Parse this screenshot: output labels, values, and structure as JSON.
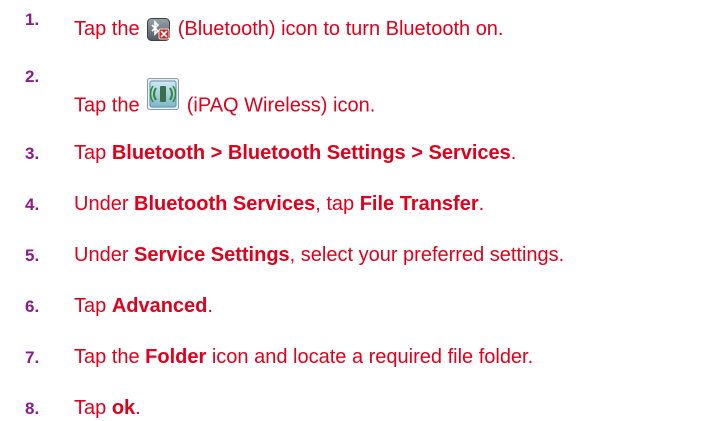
{
  "colors": {
    "number": "#8b1a8b",
    "text": "#e0001b"
  },
  "steps": [
    {
      "number": "1.",
      "parts": [
        {
          "t": "Tap the "
        },
        {
          "icon": "bluetooth-off-icon"
        },
        {
          "t": " (Bluetooth) icon to turn Bluetooth on."
        }
      ]
    },
    {
      "number": "2.",
      "parts": [
        {
          "t": "Tap the "
        },
        {
          "icon": "ipaq-wireless-icon"
        },
        {
          "t": " (iPAQ Wireless) icon."
        }
      ]
    },
    {
      "number": "3.",
      "parts": [
        {
          "t": "Tap "
        },
        {
          "t": "Bluetooth > Bluetooth Settings > Services",
          "b": true
        },
        {
          "t": "."
        }
      ]
    },
    {
      "number": "4.",
      "parts": [
        {
          "t": "Under "
        },
        {
          "t": "Bluetooth Services",
          "b": true
        },
        {
          "t": ", tap "
        },
        {
          "t": "File Transfer",
          "b": true
        },
        {
          "t": "."
        }
      ]
    },
    {
      "number": "5.",
      "parts": [
        {
          "t": "Under "
        },
        {
          "t": "Service Settings",
          "b": true
        },
        {
          "t": ", select your preferred settings."
        }
      ]
    },
    {
      "number": "6.",
      "parts": [
        {
          "t": "Tap "
        },
        {
          "t": "Advanced",
          "b": true
        },
        {
          "t": "."
        }
      ]
    },
    {
      "number": "7.",
      "parts": [
        {
          "t": "Tap the "
        },
        {
          "t": "Folder",
          "b": true
        },
        {
          "t": " icon and locate a required file folder."
        }
      ]
    },
    {
      "number": "8.",
      "parts": [
        {
          "t": "Tap "
        },
        {
          "t": "ok",
          "b": true
        },
        {
          "t": "."
        }
      ]
    }
  ]
}
